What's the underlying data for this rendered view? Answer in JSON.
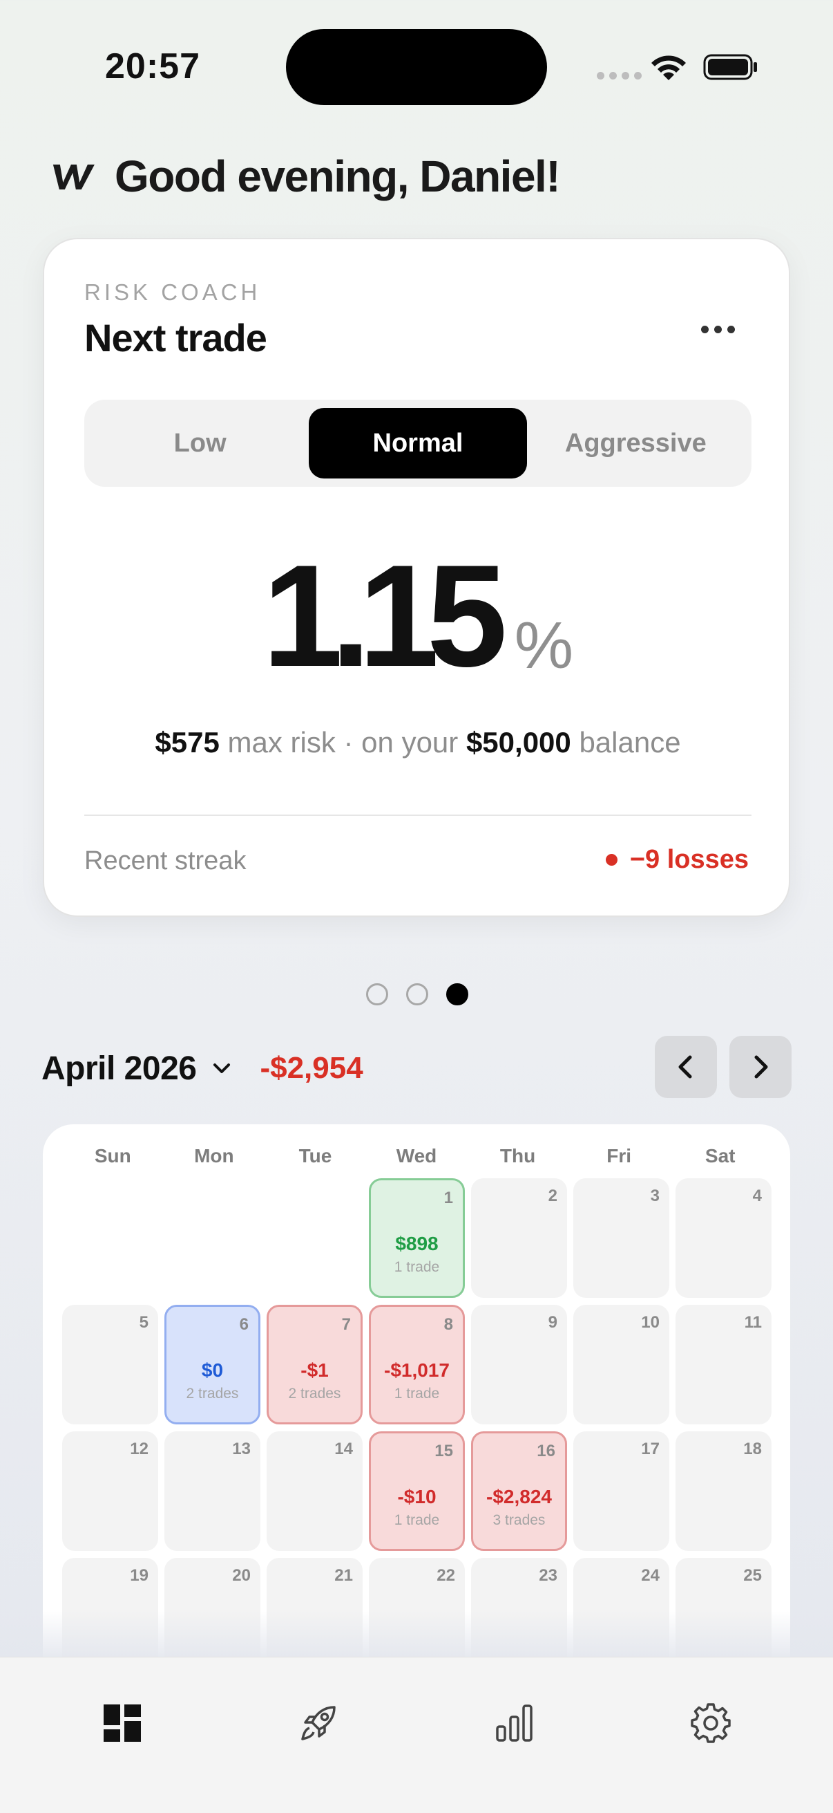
{
  "status_bar": {
    "time": "20:57"
  },
  "header": {
    "greeting": "Good evening, Daniel!"
  },
  "risk_card": {
    "eyebrow": "RISK COACH",
    "title": "Next trade",
    "segments": [
      "Low",
      "Normal",
      "Aggressive"
    ],
    "selected_segment": "Normal",
    "risk_value": "1.15",
    "risk_unit": "%",
    "max_risk": "$575",
    "max_risk_text": "max risk · on your",
    "balance": "$50,000",
    "balance_text": "balance",
    "streak_label": "Recent streak",
    "streak_value": "−9 losses"
  },
  "pager": {
    "count": 3,
    "active_index": 2
  },
  "calendar": {
    "month_label": "April 2026",
    "month_pnl": "-$2,954",
    "weekdays": [
      "Sun",
      "Mon",
      "Tue",
      "Wed",
      "Thu",
      "Fri",
      "Sat"
    ],
    "weeks": [
      [
        null,
        null,
        null,
        {
          "day": "1",
          "pnl": "$898",
          "trades": "1 trade",
          "status": "win"
        },
        {
          "day": "2"
        },
        {
          "day": "3"
        },
        {
          "day": "4"
        }
      ],
      [
        {
          "day": "5"
        },
        {
          "day": "6",
          "pnl": "$0",
          "trades": "2 trades",
          "status": "flat"
        },
        {
          "day": "7",
          "pnl": "-$1",
          "trades": "2 trades",
          "status": "loss"
        },
        {
          "day": "8",
          "pnl": "-$1,017",
          "trades": "1 trade",
          "status": "loss"
        },
        {
          "day": "9"
        },
        {
          "day": "10"
        },
        {
          "day": "11"
        }
      ],
      [
        {
          "day": "12"
        },
        {
          "day": "13"
        },
        {
          "day": "14"
        },
        {
          "day": "15",
          "pnl": "-$10",
          "trades": "1 trade",
          "status": "loss"
        },
        {
          "day": "16",
          "pnl": "-$2,824",
          "trades": "3 trades",
          "status": "loss"
        },
        {
          "day": "17"
        },
        {
          "day": "18"
        }
      ],
      [
        {
          "day": "19"
        },
        {
          "day": "20"
        },
        {
          "day": "21"
        },
        {
          "day": "22"
        },
        {
          "day": "23"
        },
        {
          "day": "24"
        },
        {
          "day": "25"
        }
      ]
    ]
  },
  "tabs": [
    {
      "icon": "dashboard-icon"
    },
    {
      "icon": "rocket-icon"
    },
    {
      "icon": "bar-chart-icon"
    },
    {
      "icon": "gear-icon"
    }
  ],
  "colors": {
    "loss": "#d93025",
    "win": "#1f9d45",
    "flat": "#1f5bd6",
    "accent": "#000000"
  }
}
